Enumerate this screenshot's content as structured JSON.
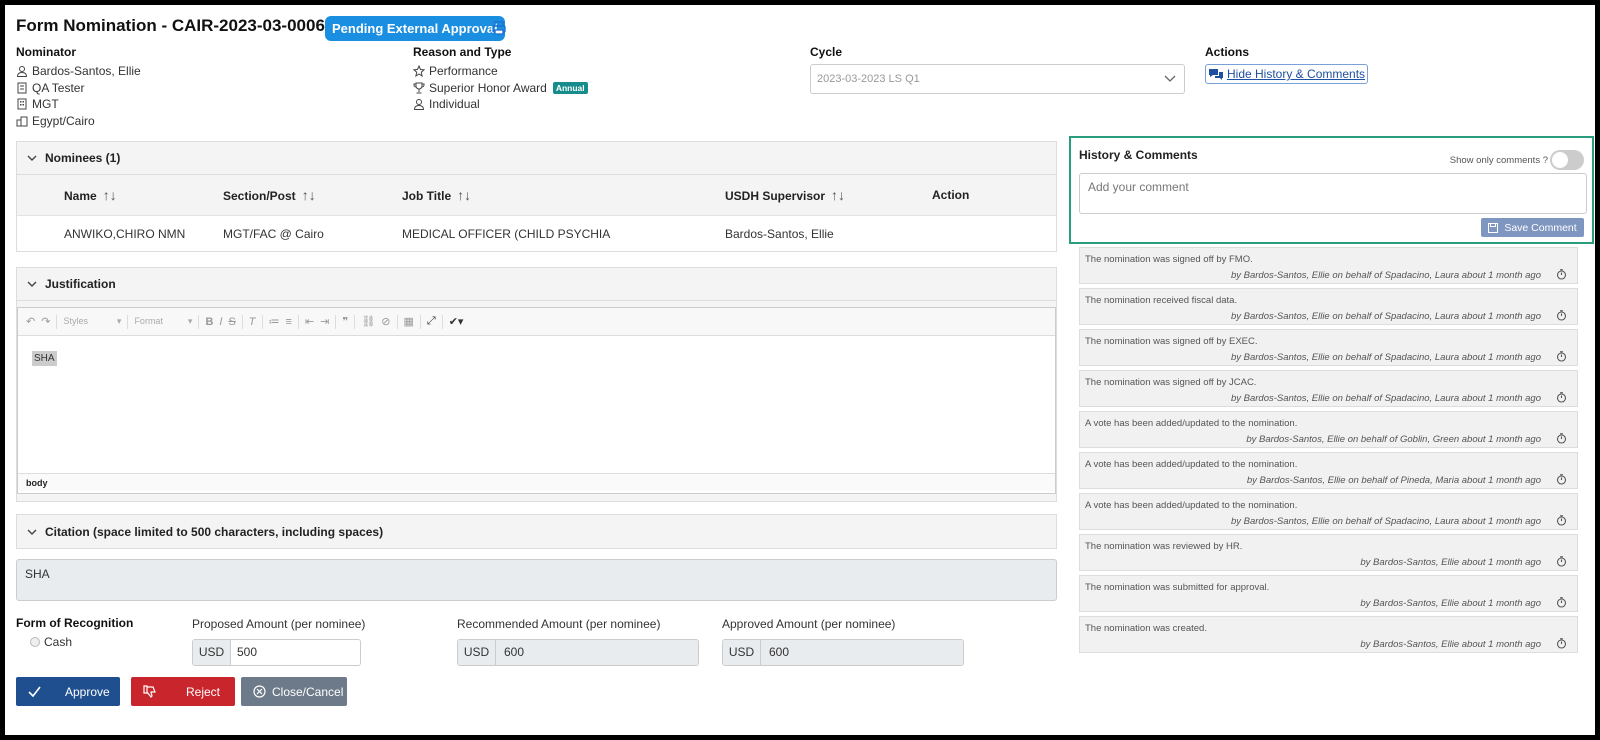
{
  "header": {
    "title": "Form Nomination - CAIR-2023-03-0006",
    "status_badge": "Pending External Approval"
  },
  "nominator": {
    "label": "Nominator",
    "name": "Bardos-Santos, Ellie",
    "title": "QA Tester",
    "org": "MGT",
    "location": "Egypt/Cairo"
  },
  "reason": {
    "label": "Reason and Type",
    "reason": "Performance",
    "award": "Superior Honor Award",
    "award_badge": "Annual",
    "type": "Individual"
  },
  "cycle": {
    "label": "Cycle",
    "value": "2023-03-2023 LS Q1"
  },
  "actions": {
    "label": "Actions",
    "toggle_history": "Hide History & Comments"
  },
  "nominees": {
    "section_title": "Nominees (1)",
    "columns": [
      "Name",
      "Section/Post",
      "Job Title",
      "USDH Supervisor",
      "Action"
    ],
    "rows": [
      {
        "name": "ANWIKO,CHIRO NMN",
        "section": "MGT/FAC @ Cairo",
        "job_title": "MEDICAL OFFICER (CHILD PSYCHIA",
        "supervisor": "Bardos-Santos, Ellie"
      }
    ]
  },
  "justification": {
    "section_title": "Justification",
    "toolbar": {
      "styles": "Styles",
      "format": "Format"
    },
    "content": "SHA",
    "status_path": "body"
  },
  "citation": {
    "section_title": "Citation (space limited to 500 characters, including spaces)",
    "value": "SHA"
  },
  "recognition": {
    "label": "Form of Recognition",
    "option": "Cash"
  },
  "amounts": {
    "currency": "USD",
    "proposed": {
      "label": "Proposed Amount (per nominee)",
      "value": "500"
    },
    "recommended": {
      "label": "Recommended Amount (per nominee)",
      "value": "600"
    },
    "approved": {
      "label": "Approved Amount (per nominee)",
      "value": "600"
    }
  },
  "buttons": {
    "approve": "Approve",
    "reject": "Reject",
    "close": "Close/Cancel"
  },
  "history": {
    "title": "History & Comments",
    "toggle_label": "Show only comments ?",
    "comment_placeholder": "Add your comment",
    "save_label": "Save Comment",
    "items": [
      {
        "message": "The nomination was signed off by FMO.",
        "by": "by Bardos-Santos, Ellie on behalf of Spadacino, Laura about 1 month ago"
      },
      {
        "message": "The nomination received fiscal data.",
        "by": "by Bardos-Santos, Ellie on behalf of Spadacino, Laura about 1 month ago"
      },
      {
        "message": "The nomination was signed off by EXEC.",
        "by": "by Bardos-Santos, Ellie on behalf of Spadacino, Laura about 1 month ago"
      },
      {
        "message": "The nomination was signed off by JCAC.",
        "by": "by Bardos-Santos, Ellie on behalf of Spadacino, Laura about 1 month ago"
      },
      {
        "message": "A vote has been added/updated to the nomination.",
        "by": "by Bardos-Santos, Ellie on behalf of Goblin, Green about 1 month ago"
      },
      {
        "message": "A vote has been added/updated to the nomination.",
        "by": "by Bardos-Santos, Ellie on behalf of Pineda, Maria about 1 month ago"
      },
      {
        "message": "A vote has been added/updated to the nomination.",
        "by": "by Bardos-Santos, Ellie on behalf of Spadacino, Laura about 1 month ago"
      },
      {
        "message": "The nomination was reviewed by HR.",
        "by": "by Bardos-Santos, Ellie about 1 month ago"
      },
      {
        "message": "The nomination was submitted for approval.",
        "by": "by Bardos-Santos, Ellie about 1 month ago"
      },
      {
        "message": "The nomination was created.",
        "by": "by Bardos-Santos, Ellie about 1 month ago"
      }
    ]
  },
  "colors": {
    "badge": "#1a8ee0",
    "approve": "#1f4f8f",
    "reject": "#c9252c",
    "close": "#6c7a89",
    "highlight_border": "#2a9d7f"
  }
}
